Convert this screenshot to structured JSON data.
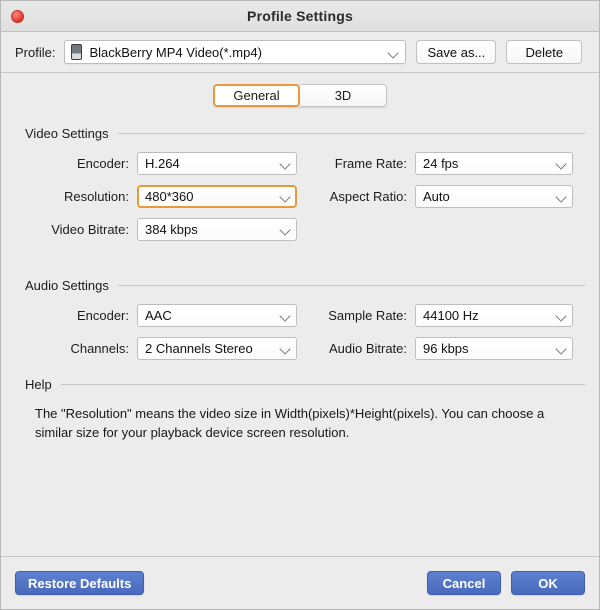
{
  "window": {
    "title": "Profile Settings",
    "close_icon": "close-icon"
  },
  "profile_bar": {
    "label": "Profile:",
    "device_icon": "device-phone-icon",
    "selected": "BlackBerry MP4 Video(*.mp4)",
    "chevron_icon": "chevron-down-icon",
    "save_as_label": "Save as...",
    "delete_label": "Delete"
  },
  "tabs": {
    "items": [
      {
        "label": "General",
        "active": true
      },
      {
        "label": "3D",
        "active": false
      }
    ]
  },
  "video_settings": {
    "title": "Video Settings",
    "encoder_label": "Encoder:",
    "encoder_value": "H.264",
    "frame_rate_label": "Frame Rate:",
    "frame_rate_value": "24 fps",
    "resolution_label": "Resolution:",
    "resolution_value": "480*360",
    "aspect_ratio_label": "Aspect Ratio:",
    "aspect_ratio_value": "Auto",
    "video_bitrate_label": "Video Bitrate:",
    "video_bitrate_value": "384 kbps"
  },
  "audio_settings": {
    "title": "Audio Settings",
    "encoder_label": "Encoder:",
    "encoder_value": "AAC",
    "sample_rate_label": "Sample Rate:",
    "sample_rate_value": "44100 Hz",
    "channels_label": "Channels:",
    "channels_value": "2 Channels Stereo",
    "audio_bitrate_label": "Audio Bitrate:",
    "audio_bitrate_value": "96 kbps"
  },
  "help": {
    "title": "Help",
    "body": "The \"Resolution\" means the video size in Width(pixels)*Height(pixels).  You can choose a similar size for your playback device screen resolution."
  },
  "footer": {
    "restore_label": "Restore Defaults",
    "cancel_label": "Cancel",
    "ok_label": "OK"
  },
  "colors": {
    "window_bg": "#ececec",
    "focus_orange": "#e79a3c",
    "button_blue": "#4a6bbd",
    "close_red": "#e0352b"
  }
}
